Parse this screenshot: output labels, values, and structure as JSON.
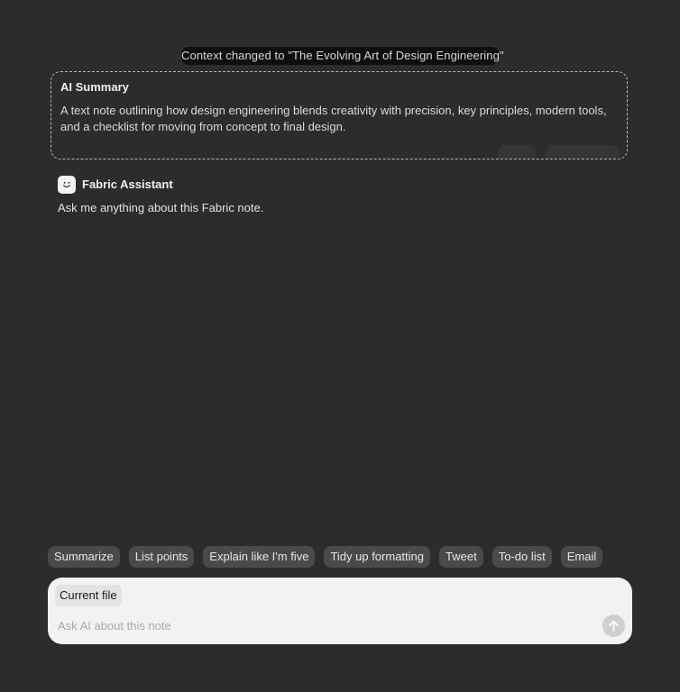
{
  "context_notice": "Context changed to \"The Evolving Art of Design Engineering\"",
  "summary": {
    "title": "AI Summary",
    "text": "A text note outlining how design engineering blends creativity with precision, key principles, modern tools, and a checklist for moving from concept to final design."
  },
  "assistant": {
    "avatar_icon": "smiley-face-icon",
    "name": "Fabric Assistant",
    "message": "Ask me anything about this Fabric note."
  },
  "suggestions": [
    "Summarize",
    "List points",
    "Explain like I'm five",
    "Tidy up formatting",
    "Tweet",
    "To-do list",
    "Email"
  ],
  "composer": {
    "context_chip": "Current file",
    "placeholder": "Ask AI about this note",
    "value": "",
    "send_icon": "arrow-up-icon"
  },
  "colors": {
    "background": "#2c2c2c",
    "chip": "#4a4a4a",
    "composer": "#f2f2f2",
    "send_button": "#cfcfcf"
  }
}
